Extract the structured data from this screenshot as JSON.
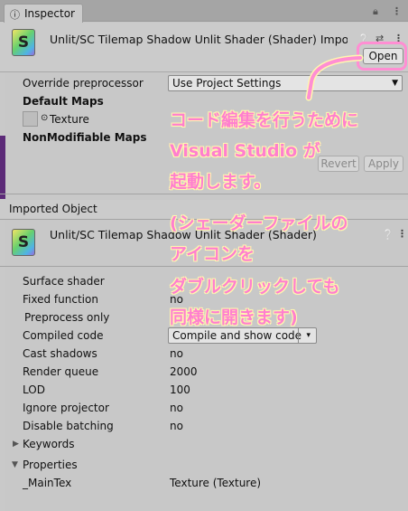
{
  "tab": {
    "label": "Inspector"
  },
  "header": {
    "title": "Unlit/SC Tilemap Shadow Unlit Shader (Shader) Import",
    "open_label": "Open"
  },
  "import_settings": {
    "override_label": "Override preprocessor",
    "override_value": "Use Project Settings",
    "default_maps_label": "Default Maps",
    "texture_label": "Texture",
    "nonmodifiable_label": "NonModifiable Maps",
    "revert_label": "Revert",
    "apply_label": "Apply"
  },
  "imported_object": {
    "section_label": "Imported Object",
    "title": "Unlit/SC Tilemap Shadow Unlit Shader (Shader)",
    "rows": [
      {
        "label": "Surface shader",
        "value": ""
      },
      {
        "label": "Fixed function",
        "value": "no"
      },
      {
        "label": "Preprocess only",
        "value": ""
      },
      {
        "label": "Compiled code",
        "value": "Compile and show code"
      },
      {
        "label": "Cast shadows",
        "value": "no"
      },
      {
        "label": "Render queue",
        "value": "2000"
      },
      {
        "label": "LOD",
        "value": "100"
      },
      {
        "label": "Ignore projector",
        "value": "no"
      },
      {
        "label": "Disable batching",
        "value": "no"
      }
    ],
    "keywords_label": "Keywords",
    "properties_label": "Properties",
    "property": {
      "name": "_MainTex",
      "value": "Texture (Texture)"
    }
  },
  "annotation": {
    "line1": "コード編集を行うために",
    "line2": "Visual Studio が",
    "line3": "起動します。",
    "line4": "(シェーダーファイルの",
    "line5": "アイコンを",
    "line6": "ダブルクリックしても",
    "line7": "同様に開きます)"
  },
  "colors": {
    "annotation_pink": "#ff7fcf",
    "annotation_outline": "#fff7b0",
    "panel_bg": "#c8c8c8"
  },
  "icons": [
    "info-icon",
    "lock-icon",
    "more-icon",
    "help-icon",
    "settings-icon",
    "shader-icon",
    "dropdown-arrow-icon",
    "foldout-arrow-icon"
  ]
}
